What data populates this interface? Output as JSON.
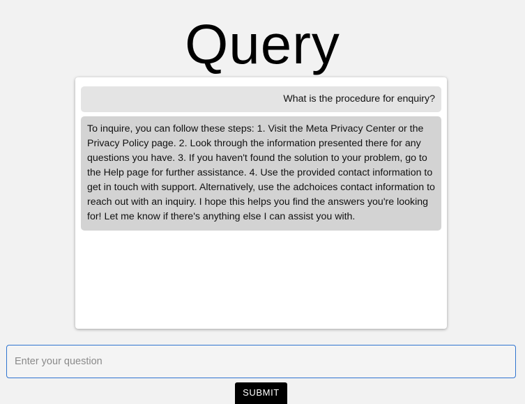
{
  "header": {
    "title": "Query"
  },
  "chat": {
    "messages": [
      {
        "role": "user",
        "text": "What is the procedure for enquiry?"
      },
      {
        "role": "assistant",
        "text": "To inquire, you can follow these steps: 1. Visit the Meta Privacy Center or the Privacy Policy page. 2. Look through the information presented there for any questions you have. 3. If you haven't found the solution to your problem, go to the Help page for further assistance. 4. Use the provided contact information to get in touch with support. Alternatively, use the adchoices contact information to reach out with an inquiry. I hope this helps you find the answers you're looking for! Let me know if there's anything else I can assist you with."
      }
    ]
  },
  "input": {
    "value": "",
    "placeholder": "Enter your question"
  },
  "submit": {
    "label": "SUBMIT"
  },
  "colors": {
    "background": "#f2f2f2",
    "panel": "#ffffff",
    "user_bubble": "#e4e4e4",
    "assistant_bubble": "#d3d3d3",
    "input_border": "#2f74d0",
    "button": "#000000"
  }
}
